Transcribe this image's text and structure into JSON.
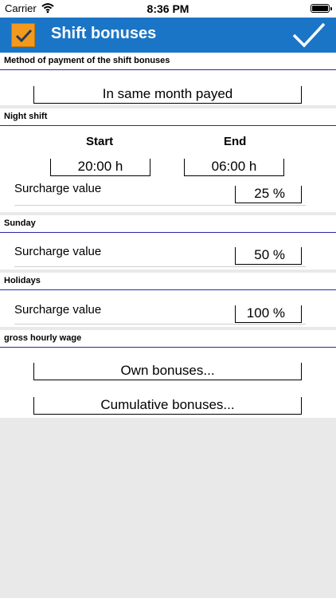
{
  "status_bar": {
    "carrier": "Carrier",
    "time": "8:36 PM"
  },
  "navbar": {
    "title": "Shift bonuses"
  },
  "payment": {
    "header": "Method of payment of the shift bonuses",
    "value": "In same month payed"
  },
  "night_shift": {
    "header": "Night shift",
    "start_label": "Start",
    "end_label": "End",
    "start_value": "20:00 h",
    "end_value": "06:00 h",
    "surcharge_label": "Surcharge value",
    "surcharge_value": "25 %"
  },
  "sunday": {
    "header": "Sunday",
    "surcharge_label": "Surcharge value",
    "surcharge_value": "50 %"
  },
  "holidays": {
    "header": "Holidays",
    "surcharge_label": "Surcharge value",
    "surcharge_value": "100 %"
  },
  "wage": {
    "header": "gross hourly wage",
    "own_bonuses": "Own bonuses...",
    "cumulative_bonuses": "Cumulative bonuses..."
  },
  "colors": {
    "navbar": "#1b75c6",
    "app_icon": "#f39a1e",
    "section_rule": "#2a2aa3",
    "background": "#e9e9e9"
  }
}
